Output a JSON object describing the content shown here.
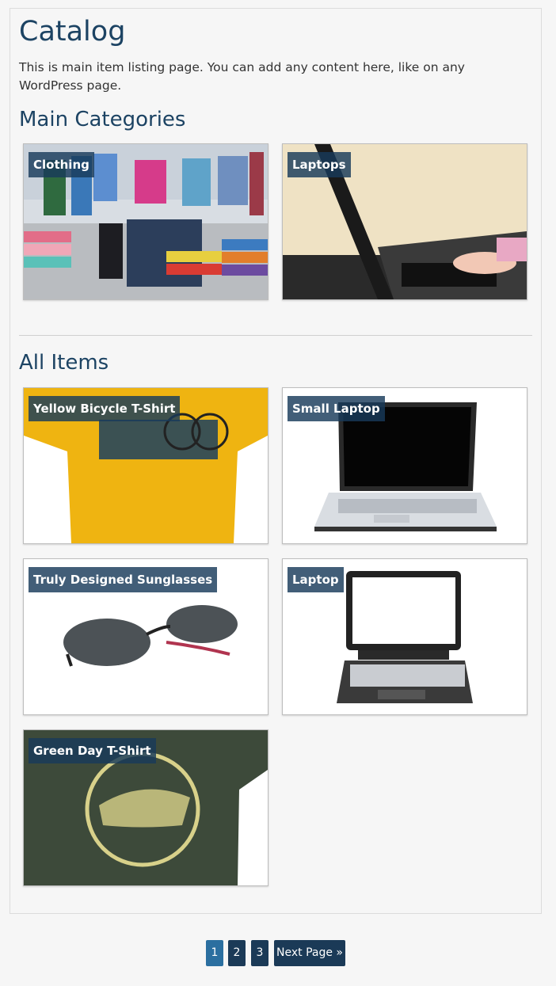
{
  "page": {
    "title": "Catalog",
    "intro": "This is main item listing page. You can add any content here, like on any WordPress page."
  },
  "categories": {
    "heading": "Main Categories",
    "items": [
      {
        "label": "Clothing"
      },
      {
        "label": "Laptops"
      }
    ]
  },
  "items": {
    "heading": "All Items",
    "list": [
      {
        "label": "Yellow Bicycle T-Shirt"
      },
      {
        "label": "Small Laptop"
      },
      {
        "label": "Truly Designed Sunglasses"
      },
      {
        "label": "Laptop"
      },
      {
        "label": "Green Day T-Shirt"
      }
    ]
  },
  "pagination": {
    "pages": [
      "1",
      "2",
      "3"
    ],
    "current": "1",
    "next_label": "Next Page »"
  }
}
